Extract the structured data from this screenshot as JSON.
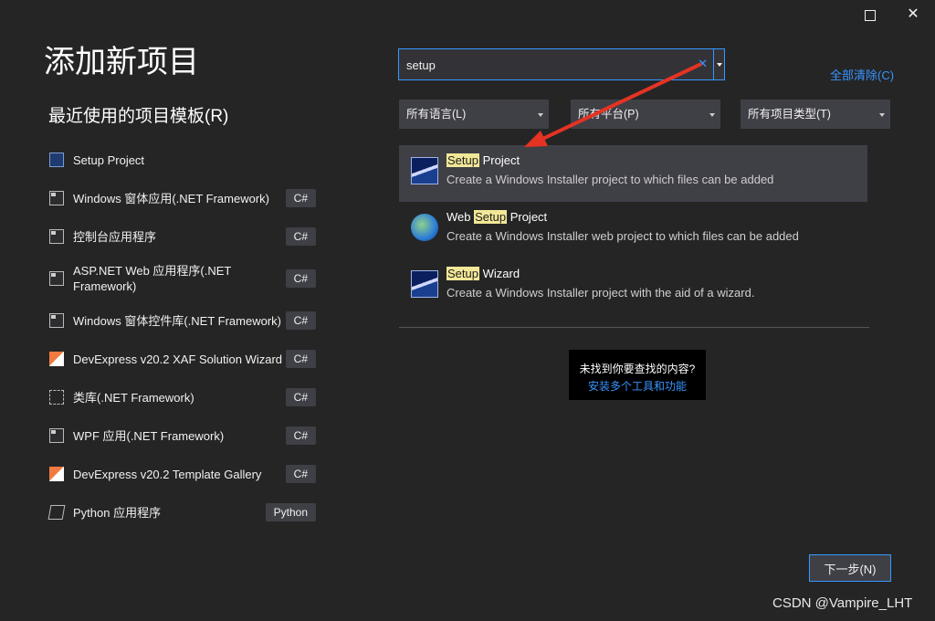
{
  "window": {
    "maximize_icon": "maximize-icon",
    "close_icon": "close-icon",
    "close_glyph": "✕"
  },
  "page_title": "添加新项目",
  "recent": {
    "title": "最近使用的项目模板(R)",
    "items": [
      {
        "label": "Setup Project",
        "tag": "",
        "icon": "setup-project-icon"
      },
      {
        "label": "Windows 窗体应用(.NET Framework)",
        "tag": "C#",
        "icon": "window-form-icon"
      },
      {
        "label": "控制台应用程序",
        "tag": "C#",
        "icon": "console-app-icon"
      },
      {
        "label": "ASP.NET Web 应用程序(.NET Framework)",
        "tag": "C#",
        "icon": "web-app-icon"
      },
      {
        "label": "Windows 窗体控件库(.NET Framework)",
        "tag": "C#",
        "icon": "control-library-icon"
      },
      {
        "label": "DevExpress v20.2 XAF Solution Wizard",
        "tag": "C#",
        "icon": "devexpress-icon"
      },
      {
        "label": "类库(.NET Framework)",
        "tag": "C#",
        "icon": "class-library-icon"
      },
      {
        "label": "WPF 应用(.NET Framework)",
        "tag": "C#",
        "icon": "wpf-app-icon"
      },
      {
        "label": "DevExpress v20.2 Template Gallery",
        "tag": "C#",
        "icon": "devexpress-icon"
      },
      {
        "label": "Python 应用程序",
        "tag": "Python",
        "icon": "python-app-icon"
      }
    ]
  },
  "search": {
    "value": "setup",
    "clear_glyph": "✕",
    "clear_all": "全部清除(C)"
  },
  "filters": {
    "language": "所有语言(L)",
    "platform": "所有平台(P)",
    "type": "所有项目类型(T)"
  },
  "results": [
    {
      "prefix": "",
      "highlight": "Setup",
      "suffix": " Project",
      "desc": "Create a Windows Installer project to which files can be added",
      "icon": "setup-project-icon",
      "selected": true
    },
    {
      "prefix": "Web ",
      "highlight": "Setup",
      "suffix": " Project",
      "desc": "Create a Windows Installer web project to which files can be added",
      "icon": "web-setup-icon",
      "selected": false
    },
    {
      "prefix": "",
      "highlight": "Setup",
      "suffix": " Wizard",
      "desc": "Create a Windows Installer project with the aid of a wizard.",
      "icon": "setup-wizard-icon",
      "selected": false
    }
  ],
  "not_found": {
    "question": "未找到你要查找的内容?",
    "link": "安装多个工具和功能"
  },
  "next_button": "下一步(N)",
  "watermark": "CSDN @Vampire_LHT",
  "colors": {
    "background": "#252526",
    "accent": "#3399ff",
    "highlight": "#f2e797",
    "arrow": "#e53323"
  }
}
